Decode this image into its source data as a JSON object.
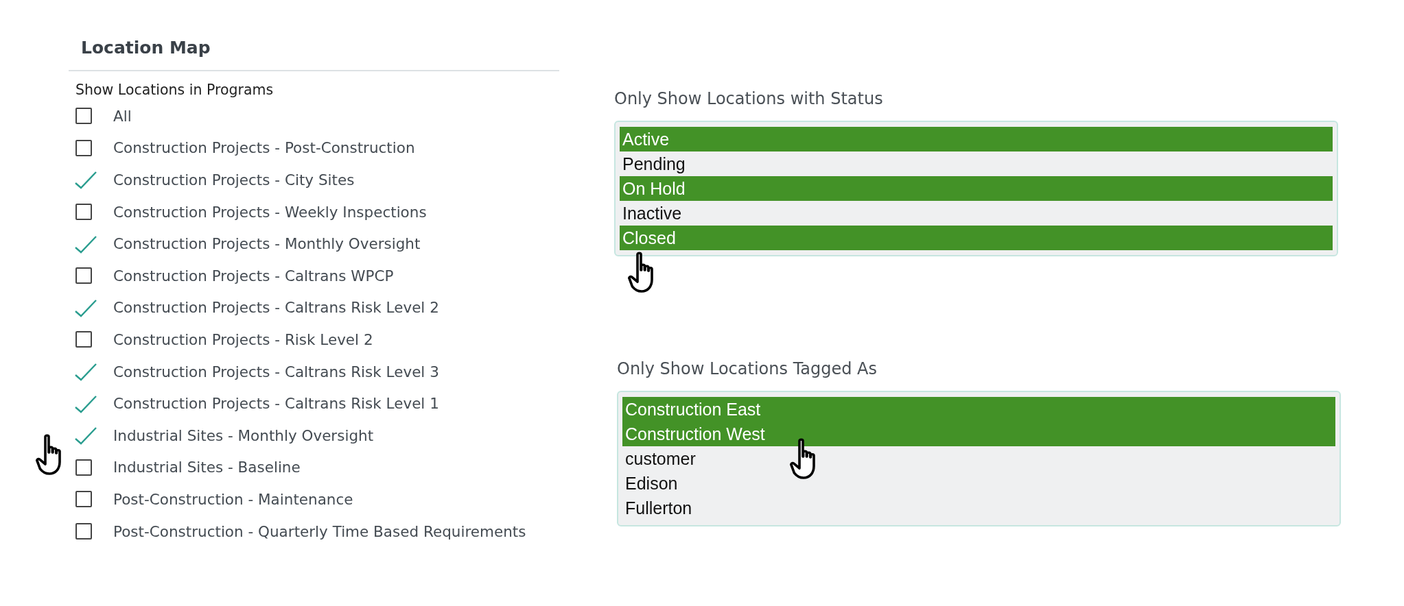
{
  "panel": {
    "title": "Location Map"
  },
  "programs": {
    "label": "Show Locations in Programs",
    "items": [
      {
        "label": "All",
        "checked": false
      },
      {
        "label": "Construction Projects - Post-Construction",
        "checked": false
      },
      {
        "label": "Construction Projects - City Sites",
        "checked": true
      },
      {
        "label": "Construction Projects - Weekly Inspections",
        "checked": false
      },
      {
        "label": "Construction Projects - Monthly Oversight",
        "checked": true
      },
      {
        "label": "Construction Projects - Caltrans WPCP",
        "checked": false
      },
      {
        "label": "Construction Projects - Caltrans Risk Level 2",
        "checked": true
      },
      {
        "label": "Construction Projects - Risk Level 2",
        "checked": false
      },
      {
        "label": "Construction Projects - Caltrans Risk Level 3",
        "checked": true
      },
      {
        "label": "Construction Projects - Caltrans Risk Level 1",
        "checked": true
      },
      {
        "label": "Industrial Sites - Monthly Oversight",
        "checked": true
      },
      {
        "label": "Industrial Sites - Baseline",
        "checked": false
      },
      {
        "label": "Post-Construction - Maintenance",
        "checked": false
      },
      {
        "label": "Post-Construction - Quarterly Time Based Requirements",
        "checked": false
      }
    ]
  },
  "status_filter": {
    "label": "Only Show Locations with Status",
    "options": [
      {
        "label": "Active",
        "selected": true
      },
      {
        "label": "Pending",
        "selected": false
      },
      {
        "label": "On Hold",
        "selected": true
      },
      {
        "label": "Inactive",
        "selected": false
      },
      {
        "label": "Closed",
        "selected": true
      }
    ]
  },
  "tag_filter": {
    "label": "Only Show Locations Tagged As",
    "options": [
      {
        "label": "Construction East",
        "selected": true
      },
      {
        "label": "Construction West",
        "selected": true
      },
      {
        "label": "customer",
        "selected": false
      },
      {
        "label": "Edison",
        "selected": false
      },
      {
        "label": "Fullerton",
        "selected": false
      }
    ]
  }
}
